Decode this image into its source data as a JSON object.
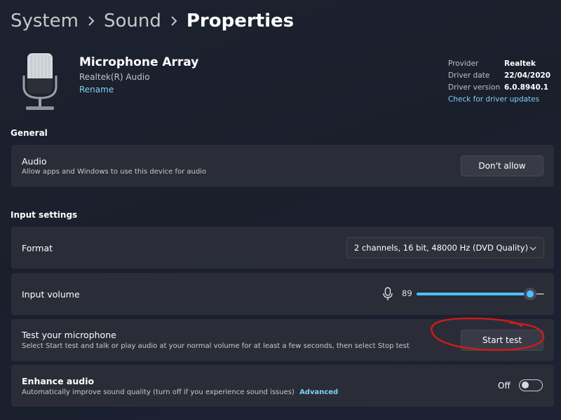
{
  "breadcrumb": {
    "items": [
      "System",
      "Sound"
    ],
    "current": "Properties"
  },
  "device": {
    "name": "Microphone Array",
    "manufacturer": "Realtek(R) Audio",
    "rename_label": "Rename"
  },
  "driver": {
    "provider_label": "Provider",
    "provider": "Realtek",
    "date_label": "Driver date",
    "date": "22/04/2020",
    "version_label": "Driver version",
    "version": "6.0.8940.1",
    "update_link": "Check for driver updates"
  },
  "general": {
    "title": "General",
    "audio": {
      "title": "Audio",
      "description": "Allow apps and Windows to use this device for audio",
      "button": "Don't allow"
    }
  },
  "input_settings": {
    "title": "Input settings",
    "format": {
      "label": "Format",
      "value": "2 channels, 16 bit, 48000 Hz (DVD Quality)"
    },
    "volume": {
      "label": "Input volume",
      "value": "89",
      "level": 0.89
    },
    "test": {
      "title": "Test your microphone",
      "description": "Select Start test and talk or play audio at your normal volume for at least a few seconds, then select Stop test",
      "button": "Start test"
    },
    "enhance": {
      "title": "Enhance audio",
      "description": "Automatically improve sound quality (turn off if you experience sound issues)",
      "advanced_link": "Advanced",
      "state": "Off"
    }
  },
  "colors": {
    "accent": "#4cc2ff",
    "annotation": "#cc1b1b",
    "link": "#7fd0f5"
  },
  "icons": {
    "chevron": "chevron-right-icon",
    "mic": "microphone-icon",
    "dropdown": "chevron-down-icon"
  }
}
